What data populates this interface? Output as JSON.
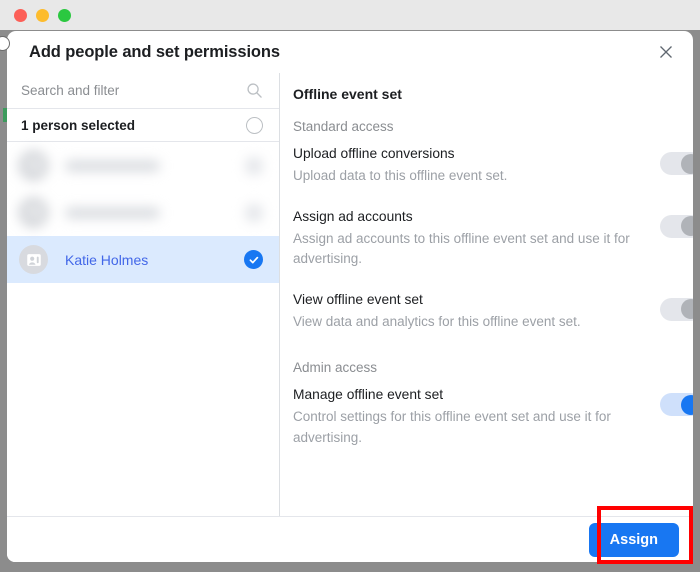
{
  "window": {
    "traffic_lights": [
      "close",
      "minimize",
      "maximize"
    ]
  },
  "dialog": {
    "title": "Add people and set permissions",
    "close_icon": "close-icon"
  },
  "left_panel": {
    "search": {
      "placeholder": "Search and filter",
      "value": "",
      "icon": "search-icon"
    },
    "selected_header": {
      "label": "1 person selected",
      "toggle_all_icon": "empty-circle-icon"
    },
    "people": [
      {
        "name": "",
        "blurred": true,
        "selected": false,
        "avatar_icon": "contact-card-icon"
      },
      {
        "name": "",
        "blurred": true,
        "selected": false,
        "avatar_icon": "contact-card-icon"
      },
      {
        "name": "Katie Holmes",
        "blurred": false,
        "selected": true,
        "avatar_icon": "contact-card-icon",
        "check_icon": "check-circle-icon"
      }
    ]
  },
  "right_panel": {
    "section_title": "Offline event set",
    "groups": [
      {
        "label": "Standard access",
        "permissions": [
          {
            "name": "Upload offline conversions",
            "description": "Upload data to this offline event set.",
            "enabled": false
          },
          {
            "name": "Assign ad accounts",
            "description": "Assign ad accounts to this offline event set and use it for advertising.",
            "enabled": false
          },
          {
            "name": "View offline event set",
            "description": "View data and analytics for this offline event set.",
            "enabled": false
          }
        ]
      },
      {
        "label": "Admin access",
        "permissions": [
          {
            "name": "Manage offline event set",
            "description": "Control settings for this offline event set and use it for advertising.",
            "enabled": true
          }
        ]
      }
    ]
  },
  "footer": {
    "assign_label": "Assign"
  },
  "annotation": {
    "highlight_color": "#ff0000",
    "target": "assign-button"
  },
  "colors": {
    "accent_blue": "#1877f2",
    "link_blue": "#4267e8",
    "selected_row_bg": "#dbeafe",
    "toggle_off_track": "#e4e6eb",
    "toggle_off_knob": "#b0b3b8",
    "toggle_on_track": "#cfe0fb",
    "title_text": "#1c1e21",
    "muted_text": "#8a8d91"
  }
}
